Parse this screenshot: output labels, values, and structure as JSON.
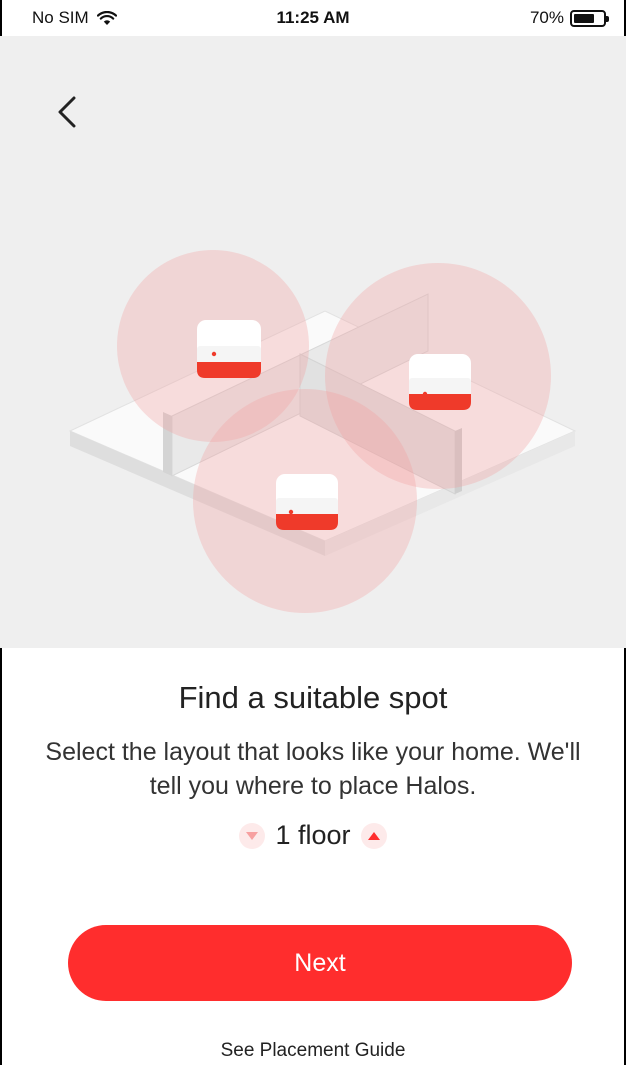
{
  "status_bar": {
    "carrier": "No SIM",
    "time": "11:25 AM",
    "battery_percent": "70%",
    "battery_level": 0.7
  },
  "nav": {
    "back_icon": "chevron-left-icon"
  },
  "content": {
    "title": "Find a suitable spot",
    "description": "Select the layout that looks like your home. We'll tell you where to place Halos.",
    "floor_label": "1 floor"
  },
  "actions": {
    "next_label": "Next",
    "guide_link": "See Placement Guide"
  },
  "colors": {
    "accent": "#ff2d2d",
    "hero_bg": "#efefef"
  }
}
